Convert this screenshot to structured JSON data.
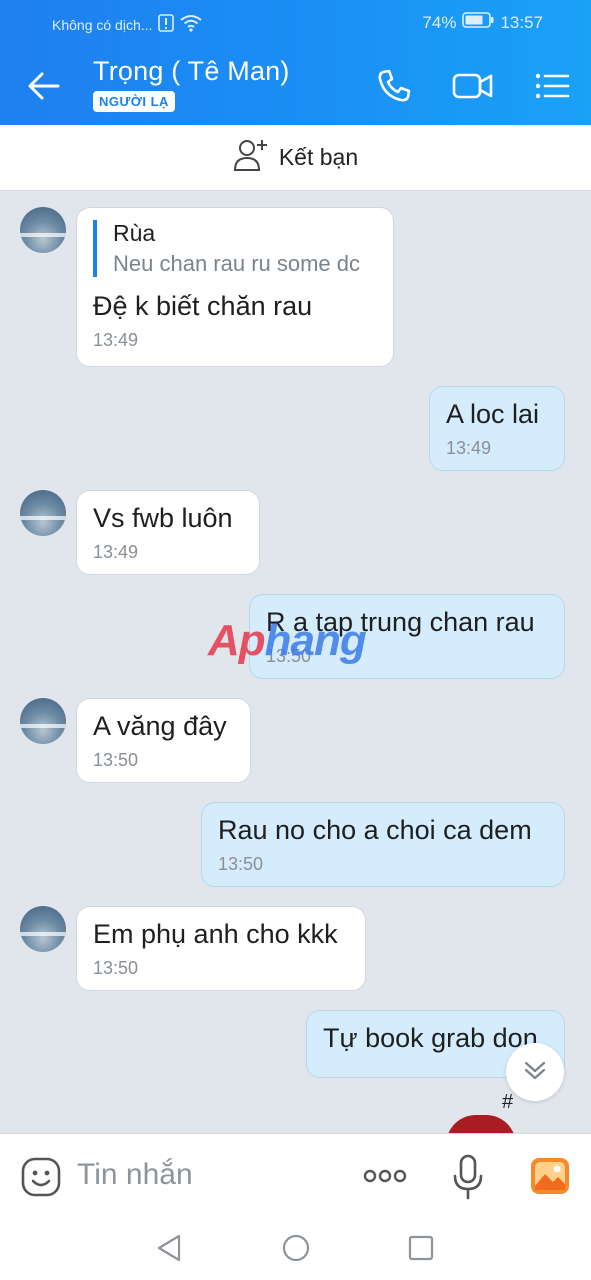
{
  "status_bar": {
    "network": "Không có dịch...",
    "battery": "74%",
    "time": "13:57"
  },
  "header": {
    "contact_name": "Trọng ( Tê Man)",
    "badge": "NGƯỜI LẠ",
    "icons": [
      "back-arrow-icon",
      "phone-icon",
      "video-call-icon",
      "menu-list-icon"
    ]
  },
  "friend_bar": {
    "label": "Kết bạn",
    "icon": "add-friend-icon"
  },
  "messages": [
    {
      "dir": "in",
      "quote_name": "Rùa",
      "quote_text": "Neu chan rau ru some dc",
      "text": "Đệ k biết chăn rau",
      "time": "13:49"
    },
    {
      "dir": "out",
      "text": "A loc lai",
      "time": "13:49"
    },
    {
      "dir": "in",
      "text": "Vs fwb luôn",
      "time": "13:49"
    },
    {
      "dir": "out",
      "text": "R a tap trung chan rau",
      "time": "13:50"
    },
    {
      "dir": "in",
      "text": "A văng đây",
      "time": "13:50"
    },
    {
      "dir": "out",
      "text": "Rau no cho a choi ca dem",
      "time": "13:50"
    },
    {
      "dir": "in",
      "text": "Em phụ anh cho kkk",
      "time": "13:50"
    },
    {
      "dir": "out",
      "text": "Tự book grab don",
      "time": ""
    }
  ],
  "watermark": {
    "part1": "Ap",
    "part2": "hang"
  },
  "input_bar": {
    "placeholder": "Tin nhắn",
    "icons": [
      "sticker-icon",
      "more-icon",
      "microphone-icon",
      "image-icon"
    ]
  },
  "nav_bar": {
    "icons": [
      "nav-back-icon",
      "nav-home-icon",
      "nav-recent-icon"
    ]
  },
  "colors": {
    "header_blue": "#1a8af3",
    "outgoing_bubble": "#d4ecfc",
    "incoming_bubble": "#ffffff",
    "chat_bg": "#e1e6ec"
  }
}
